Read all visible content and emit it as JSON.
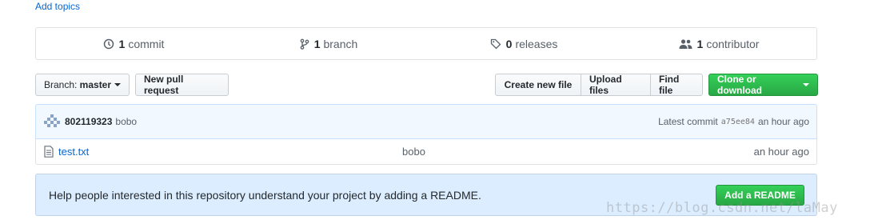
{
  "add_topics": "Add topics",
  "stats": {
    "commits": {
      "count": "1",
      "label": "commit",
      "icon": "history-icon"
    },
    "branches": {
      "count": "1",
      "label": "branch",
      "icon": "branch-icon"
    },
    "releases": {
      "count": "0",
      "label": "releases",
      "icon": "tag-icon"
    },
    "contributors": {
      "count": "1",
      "label": "contributor",
      "icon": "people-icon"
    }
  },
  "toolbar": {
    "branch_prefix": "Branch:",
    "branch_name": "master",
    "new_pull_request": "New pull request",
    "create_new_file": "Create new file",
    "upload_files": "Upload files",
    "find_file": "Find file",
    "clone_or_download": "Clone or download"
  },
  "latest_commit": {
    "author": "802119323",
    "message": "bobo",
    "latest_label": "Latest commit",
    "sha": "a75ee84",
    "time": "an hour ago"
  },
  "files": [
    {
      "name": "test.txt",
      "message": "bobo",
      "age": "an hour ago"
    }
  ],
  "readme": {
    "text": "Help people interested in this repository understand your project by adding a README.",
    "button": "Add a README"
  },
  "watermark": "https://blog.csdn.net/laMay"
}
